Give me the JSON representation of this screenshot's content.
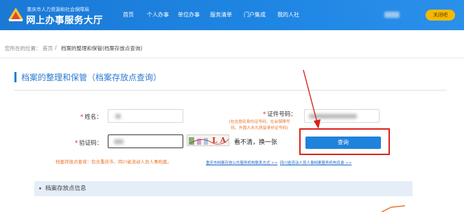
{
  "header": {
    "org_name": "重庆市人力资源和社会保障局",
    "site_name": "网上办事服务大厅",
    "nav": [
      "首页",
      "个人办事",
      "单位办事",
      "服务清单",
      "门户集成",
      "我的人社"
    ],
    "login_label": "关闭吧"
  },
  "breadcrumb": {
    "prefix": "您所在的位置：",
    "home": "首页",
    "separator": "/",
    "current": "档案的整理和保管(档案存放点查询)"
  },
  "section": {
    "title": "档案的整理和保管（档案存放点查询）"
  },
  "form": {
    "name_label": "姓名：",
    "id_label": "证件号码：",
    "id_note": [
      "(包含居民身份证号码、社会保障号",
      "码、外国人永久居留身份证号码)"
    ],
    "captcha_label": "验证码：",
    "captcha_refresh": "看不清，换一张",
    "query_button": "查询",
    "required_mark": "*",
    "captcha_text": "L A"
  },
  "tip": "档案存放点查询：包含重庆市、四川省流动人员人事档案。",
  "links": [
    "重庆市档案存放公共服务机构联系方式 >>",
    "四川省流动人员人事档案服务机构目录 >>"
  ],
  "panel": {
    "title": "档案存放点信息"
  },
  "colors": {
    "header_blue": "#1b79d6",
    "accent_blue": "#1f82dd",
    "annotation_red": "#d9201b",
    "note_orange": "#e8742a"
  }
}
